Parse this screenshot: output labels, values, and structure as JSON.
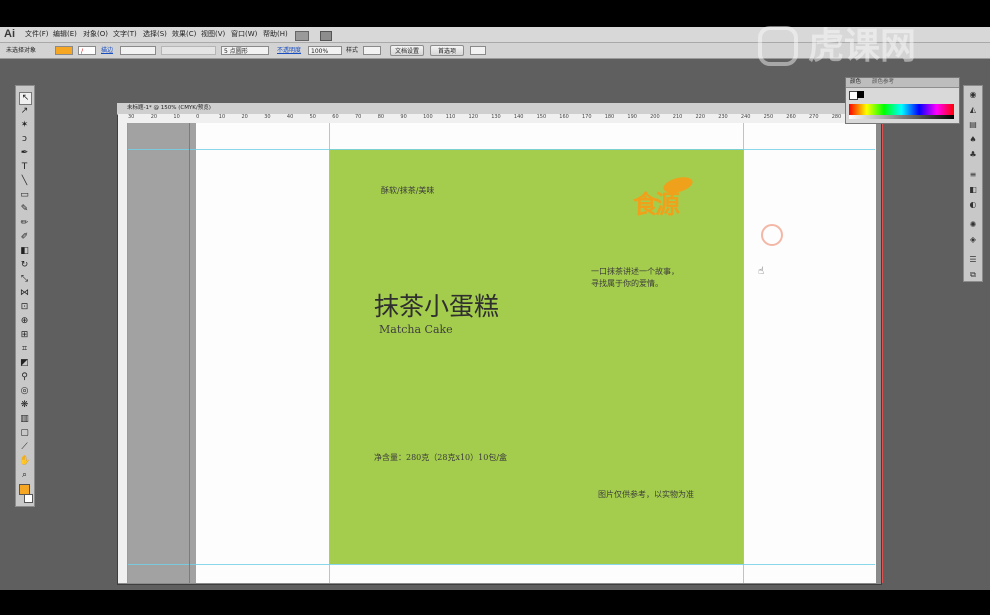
{
  "app": {
    "logo": "Ai"
  },
  "menu": [
    "文件(F)",
    "编辑(E)",
    "对象(O)",
    "文字(T)",
    "选择(S)",
    "效果(C)",
    "视图(V)",
    "窗口(W)",
    "帮助(H)"
  ],
  "control_bar": {
    "no_selection": "未选择对象",
    "stroke_label": "描边",
    "stroke_profile": "5 点圆形",
    "opacity_label": "不透明度",
    "opacity_value": "100%",
    "style_label": "样式",
    "doc_setup": "文档设置",
    "preferences": "首选项"
  },
  "document": {
    "tab_title": "未标题-1* @ 150% (CMYK/预览)"
  },
  "ruler_labels": [
    "30",
    "20",
    "10",
    "0",
    "10",
    "20",
    "30",
    "40",
    "50",
    "60",
    "70",
    "80",
    "90",
    "100",
    "110",
    "120",
    "130",
    "140",
    "150",
    "160",
    "170",
    "180",
    "190",
    "200",
    "210",
    "220",
    "230",
    "240",
    "250",
    "260",
    "270",
    "280",
    "290"
  ],
  "color_panel": {
    "tab1": "颜色",
    "tab2": "颜色参考"
  },
  "artwork": {
    "tagline": "酥软/抹茶/美味",
    "title": "抹茶小蛋糕",
    "subtitle": "Matcha Cake",
    "story_line1": "一口抹茶讲述一个故事，",
    "story_line2": "寻找属于你的爱情。",
    "net_content": "净含量：280克（28克x10）10包/盒",
    "disclaimer": "图片仅供参考，以实物为准",
    "logo_text": "食源",
    "green": "#a4cd4d",
    "logo_color": "#f0a11b"
  },
  "watermark": {
    "text": "虎课网"
  }
}
